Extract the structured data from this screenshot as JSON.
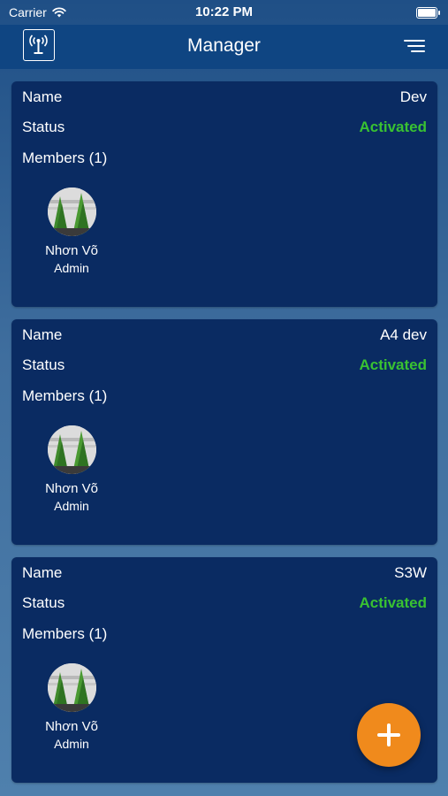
{
  "status_bar": {
    "carrier": "Carrier",
    "time": "10:22 PM"
  },
  "header": {
    "title": "Manager",
    "logo_icon": "antenna-icon",
    "menu_icon": "menu-icon"
  },
  "labels": {
    "name": "Name",
    "status": "Status"
  },
  "groups": [
    {
      "name": "Dev",
      "status": "Activated",
      "members_label": "Members (1)",
      "member": {
        "name": "Nhơn Võ",
        "role": "Admin"
      }
    },
    {
      "name": "A4 dev",
      "status": "Activated",
      "members_label": "Members (1)",
      "member": {
        "name": "Nhơn Võ",
        "role": "Admin"
      }
    },
    {
      "name": "S3W",
      "status": "Activated",
      "members_label": "Members (1)",
      "member": {
        "name": "Nhơn Võ",
        "role": "Admin"
      }
    }
  ],
  "fab": {
    "icon": "plus-icon"
  },
  "colors": {
    "nav_bg": "#0f4582",
    "card_bg": "#0a2b62",
    "status_active": "#39c232",
    "fab": "#f08a1c"
  }
}
